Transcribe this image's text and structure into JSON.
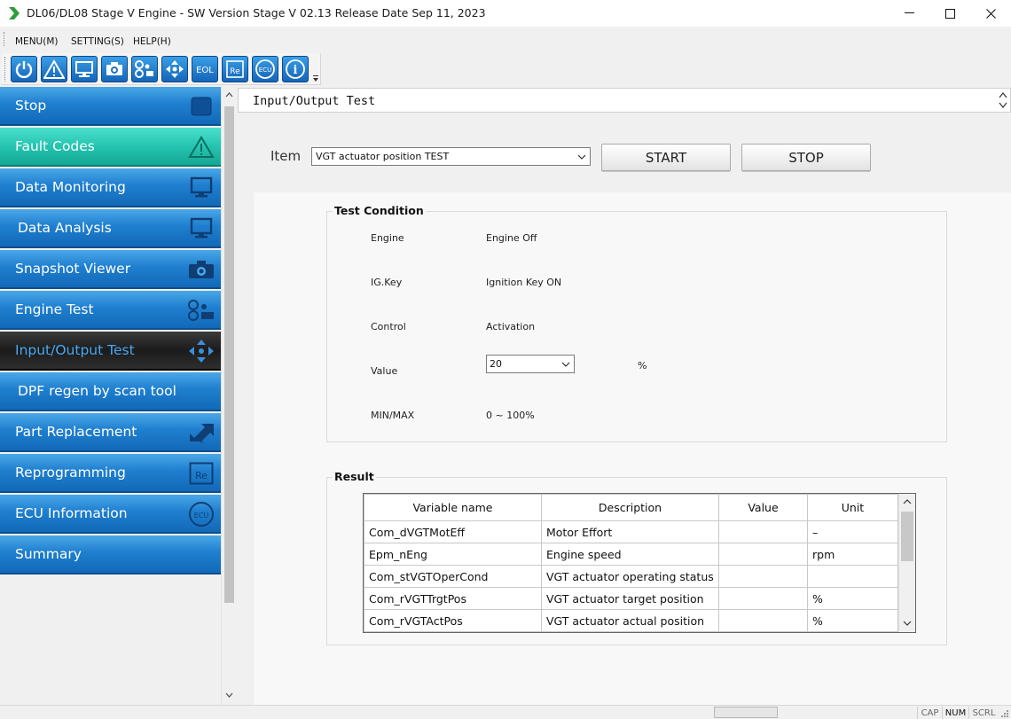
{
  "window": {
    "title": "DL06/DL08 Stage V Engine - SW Version Stage V 02.13 Release Date Sep 11, 2023"
  },
  "menu": {
    "items": [
      "MENU(M)",
      "SETTING(S)",
      "HELP(H)"
    ]
  },
  "toolbar": {
    "buttons": [
      {
        "icon": "power-icon"
      },
      {
        "icon": "warning-icon"
      },
      {
        "icon": "monitor-icon"
      },
      {
        "icon": "camera-icon"
      },
      {
        "icon": "engine-test-icon"
      },
      {
        "icon": "arrows-move-icon"
      },
      {
        "icon": "eol-icon",
        "text": "EOL"
      },
      {
        "icon": "reprogram-icon",
        "text": "Re"
      },
      {
        "icon": "ecu-icon",
        "text": "ECU"
      },
      {
        "icon": "info-icon",
        "text": "i"
      }
    ]
  },
  "sidebar": {
    "items": [
      {
        "label": "Stop",
        "icon": "stop-icon"
      },
      {
        "label": "Fault Codes",
        "icon": "warning-icon"
      },
      {
        "label": "Data Monitoring",
        "icon": "monitor-icon"
      },
      {
        "label": "Data Analysis",
        "icon": "monitor-icon"
      },
      {
        "label": "Snapshot Viewer",
        "icon": "camera-icon"
      },
      {
        "label": "Engine Test",
        "icon": "engine-test-icon"
      },
      {
        "label": "Input/Output Test",
        "icon": "arrows-move-icon",
        "active": true
      },
      {
        "label": "DPF regen by scan tool",
        "icon": ""
      },
      {
        "label": "Part Replacement",
        "icon": "part-replace-icon"
      },
      {
        "label": "Reprogramming",
        "icon": "reprogram-icon",
        "icon_text": "Re"
      },
      {
        "label": "ECU Information",
        "icon": "ecu-icon",
        "icon_text": "ECU"
      },
      {
        "label": "Summary",
        "icon": ""
      }
    ]
  },
  "main": {
    "title": "Input/Output Test",
    "item_label": "Item",
    "item_selected": "VGT actuator position TEST",
    "start_label": "START",
    "stop_label": "STOP",
    "test_condition": {
      "title": "Test Condition",
      "rows": [
        {
          "label": "Engine",
          "value": "Engine Off"
        },
        {
          "label": "IG.Key",
          "value": "Ignition Key ON"
        },
        {
          "label": "Control",
          "value": "Activation"
        },
        {
          "label": "Value",
          "value": "20",
          "unit": "%"
        },
        {
          "label": "MIN/MAX",
          "value": "0 ~ 100%"
        }
      ]
    },
    "result": {
      "title": "Result",
      "columns": [
        "Variable name",
        "Description",
        "Value",
        "Unit"
      ],
      "rows": [
        [
          "Com_dVGTMotEff",
          "Motor Effort",
          "",
          "–"
        ],
        [
          "Epm_nEng",
          "Engine speed",
          "",
          "rpm"
        ],
        [
          "Com_stVGTOperCond",
          "VGT actuator operating status",
          "",
          ""
        ],
        [
          "Com_rVGTTrgtPos",
          "VGT actuator target position",
          "",
          "%"
        ],
        [
          "Com_rVGTActPos",
          "VGT actuator actual position",
          "",
          "%"
        ]
      ]
    }
  },
  "statusbar": {
    "cap": "CAP",
    "num": "NUM",
    "scrl": "SCRL"
  },
  "colors": {
    "nav_blue": "#1f7fcf",
    "nav_teal": "#25c4b0",
    "nav_active_bg": "#1b1b1b",
    "nav_active_text": "#4aa8f2"
  }
}
